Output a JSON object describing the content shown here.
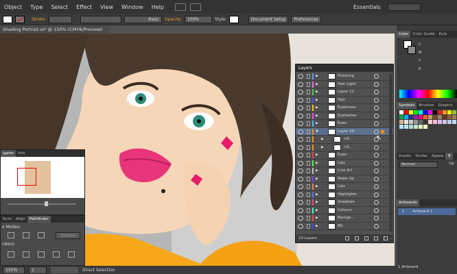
{
  "menu": [
    "Object",
    "Type",
    "Select",
    "Effect",
    "View",
    "Window",
    "Help"
  ],
  "app": {
    "workspace": "Essentials",
    "search_placeholder": ""
  },
  "control": {
    "stroke_label": "Stroke:",
    "stroke_style": "Basic",
    "opacity_label": "Opacity:",
    "opacity_value": "100%",
    "style_label": "Style:",
    "doc_setup": "Document Setup",
    "preferences": "Preferences"
  },
  "document": {
    "tab": "Shading Portrait.ai* @ 150% (CMYK/Preview)"
  },
  "status": {
    "zoom": "150%",
    "page": "1",
    "tool": "Direct Selection"
  },
  "navigator": {
    "tabs": [
      "igator",
      "Info"
    ]
  },
  "pathfinder": {
    "tabs": [
      "form",
      "Align",
      "Pathfinder"
    ],
    "shape_modes": "e Modes:",
    "pathfinders": "nders:",
    "expand": "Expand"
  },
  "layers": {
    "title": "Layers",
    "count": "19 Layers",
    "rows": [
      {
        "name": "Finishing",
        "color": "#4fa3ff",
        "indent": 0,
        "sel": false
      },
      {
        "name": "Hair Light",
        "color": "#f26ff2",
        "indent": 0,
        "sel": false
      },
      {
        "name": "Layer 12",
        "color": "#4fcf4f",
        "indent": 0,
        "sel": false
      },
      {
        "name": "Hair",
        "color": "#4f4fff",
        "indent": 0,
        "sel": false
      },
      {
        "name": "Eyebrows",
        "color": "#ffbf00",
        "indent": 0,
        "sel": false
      },
      {
        "name": "Eyelashes",
        "color": "#ff3fff",
        "indent": 0,
        "sel": false
      },
      {
        "name": "Eyes",
        "color": "#3fbfff",
        "indent": 0,
        "sel": false
      },
      {
        "name": "Layer 19",
        "color": "#ff8c1a",
        "indent": 0,
        "sel": true
      },
      {
        "name": "<G...",
        "color": "#ff8c1a",
        "indent": 1,
        "sel": false
      },
      {
        "name": "<G...",
        "color": "#ff8c1a",
        "indent": 1,
        "sel": false
      },
      {
        "name": "Eyes",
        "color": "#ff3f3f",
        "indent": 0,
        "sel": false
      },
      {
        "name": "Lips",
        "color": "#3fff3f",
        "indent": 0,
        "sel": false
      },
      {
        "name": "Line Art",
        "color": "#bfbfbf",
        "indent": 0,
        "sel": false
      },
      {
        "name": "Make Up",
        "color": "#7f3fff",
        "indent": 0,
        "sel": false
      },
      {
        "name": "Lips",
        "color": "#ff7f3f",
        "indent": 0,
        "sel": false
      },
      {
        "name": "Highlights",
        "color": "#3f7fff",
        "indent": 0,
        "sel": false
      },
      {
        "name": "Shadows",
        "color": "#ff3f7f",
        "indent": 0,
        "sel": false
      },
      {
        "name": "Colours",
        "color": "#3fffbf",
        "indent": 0,
        "sel": false
      },
      {
        "name": "Backgr...",
        "color": "#ff3f3f",
        "indent": 0,
        "sel": false
      },
      {
        "name": "BG",
        "color": "#3f3fff",
        "indent": 0,
        "sel": false
      }
    ]
  },
  "color_panel": {
    "tabs": [
      "Color",
      "Color Guide",
      "Kule"
    ],
    "channels": [
      "C",
      "M",
      "Y",
      "K"
    ]
  },
  "swatch_panel": {
    "tabs": [
      "Symbols",
      "Brushes",
      "Graphic"
    ]
  },
  "gradient_panel": {
    "tabs": [
      "Gradie",
      "Stroke",
      "Appea",
      "Tr"
    ],
    "blend": "Normal",
    "opacity_label": "Op"
  },
  "artboards": {
    "tab": "Artboards",
    "items": [
      {
        "num": "1",
        "name": "Artboard 1"
      }
    ],
    "count": "1 Artboard"
  },
  "swatch_colors": [
    "#ffffff",
    "#ff0000",
    "#ffff00",
    "#00ff00",
    "#00ffff",
    "#0000ff",
    "#ff00ff",
    "#000000",
    "#ed1c24",
    "#f7941d",
    "#fff200",
    "#8dc63f",
    "#00a651",
    "#00aeef",
    "#2e3192",
    "#92278f",
    "#ec008c",
    "#f26522",
    "#c69c6d",
    "#754c24",
    "#998675",
    "#603813",
    "#8b5e3c",
    "#a67c52",
    "#d2b48c",
    "#e6e6e6",
    "#cccccc",
    "#999999",
    "#666666",
    "#333333",
    "#ffcdd2",
    "#f8bbd0",
    "#e1bee7",
    "#d1c4e9",
    "#c5cae9",
    "#bbdefb",
    "#b3e5fc",
    "#b2ebf2",
    "#b2dfdb",
    "#c8e6c9",
    "#dcedc8",
    "#f0f4c3"
  ]
}
